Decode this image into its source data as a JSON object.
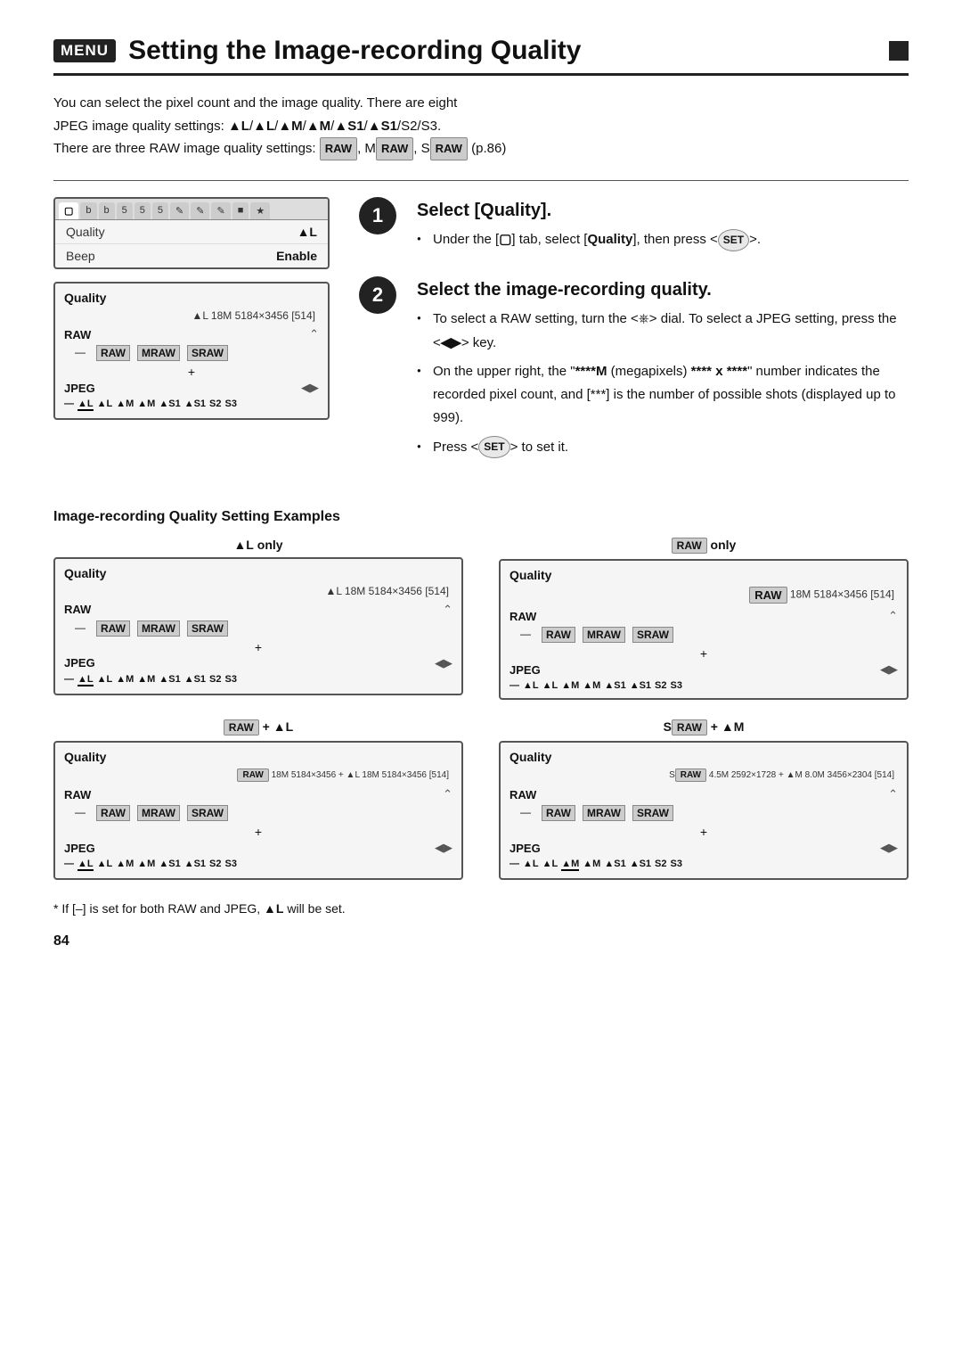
{
  "header": {
    "menu_badge": "MENU",
    "title": "Setting the Image-recording Quality"
  },
  "intro": {
    "line1": "You can select the pixel count and the image quality. There are eight",
    "line2_prefix": "JPEG image quality settings: ▲L / ▲L / ▲M / ▲M / ▲S1 / ▲S1 / S2 / S3.",
    "line3_prefix": "There are three RAW image quality settings:",
    "line3_raw1": "RAW",
    "line3_mid": ", M",
    "line3_raw2": "RAW",
    "line3_s": ", S",
    "line3_raw3": "RAW",
    "line3_suffix": " (p.86)"
  },
  "step1": {
    "number": "1",
    "heading": "Select [Quality].",
    "bullets": [
      "Under the [▢] tab, select [Quality], then press < (SET) >."
    ]
  },
  "step2": {
    "number": "2",
    "heading": "Select the image-recording quality.",
    "bullets": [
      "To select a RAW setting, turn the < ⋯ > dial. To select a JPEG setting, press the < ◀▶ > key.",
      "On the upper right, the \"****M (megapixels) **** x ****\" number indicates the recorded pixel count, and [***] is the number of possible shots (displayed up to 999).",
      "Press < (SET) > to set it."
    ]
  },
  "camera_menu": {
    "rows": [
      {
        "label": "Quality",
        "value": "▲L"
      },
      {
        "label": "Beep",
        "value": "Enable"
      }
    ]
  },
  "quality_screen_main": {
    "title": "Quality",
    "info": "▲L 18M 5184×3456 [514]",
    "raw_label": "RAW",
    "raw_options": [
      "—",
      "RAW",
      "MRAW",
      "SRAW"
    ],
    "jpeg_label": "JPEG",
    "jpeg_options": [
      "—",
      "▲L",
      "▲L",
      "▲M",
      "▲M",
      "▲S1",
      "▲S1",
      "S2",
      "S3"
    ]
  },
  "examples_section": {
    "heading": "Image-recording Quality Setting Examples",
    "examples": [
      {
        "label": "▲L only",
        "info": "▲L 18M 5184×3456 [514]"
      },
      {
        "label": "RAW only",
        "info": "RAW 18M 5184×3456 [514]"
      },
      {
        "label": "RAW + ▲L",
        "info": "RAW 18M 5184×3456 + ▲L 18M 5184×3456 [514]"
      },
      {
        "label": "S RAW + ▲M",
        "info": "SRAW 4.5M 2592×1728 + ▲M 8.0M 3456×2304 [514]"
      }
    ]
  },
  "footer": {
    "note": "* If [–] is set for both RAW and JPEG, ▲L will be set."
  },
  "page_number": "84"
}
